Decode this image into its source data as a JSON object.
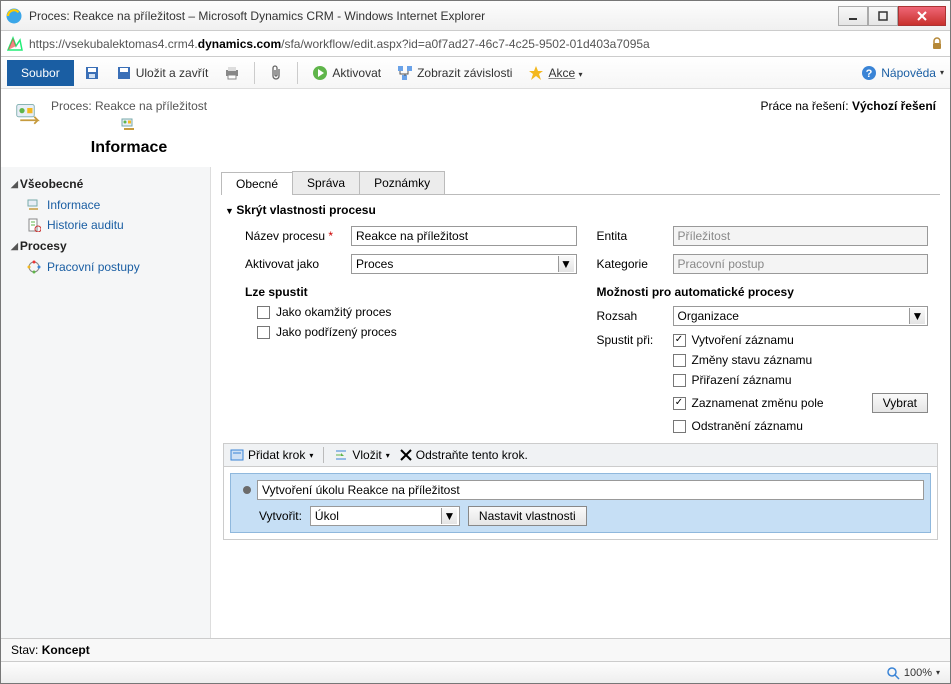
{
  "window": {
    "title": "Proces: Reakce na příležitost – Microsoft Dynamics CRM - Windows Internet Explorer"
  },
  "address": {
    "protocol": "https",
    "host_pre": "://vsekubalektomas4.crm4.",
    "host_bold": "dynamics.com",
    "path": "/sfa/workflow/edit.aspx?id=a0f7ad27-46c7-4c25-9502-01d403a7095a"
  },
  "ribbon": {
    "soubor": "Soubor",
    "save_close": "Uložit a zavřít",
    "activate": "Aktivovat",
    "show_deps": "Zobrazit závislosti",
    "actions": "Akce",
    "help": "Nápověda"
  },
  "header": {
    "subtitle": "Proces: Reakce na příležitost",
    "title": "Informace",
    "solution_label": "Práce na řešení:",
    "solution_value": "Výchozí řešení"
  },
  "sidebar": {
    "sec1": "Všeobecné",
    "items1": [
      {
        "label": "Informace"
      },
      {
        "label": "Historie auditu"
      }
    ],
    "sec2": "Procesy",
    "items2": [
      {
        "label": "Pracovní postupy"
      }
    ]
  },
  "tabs": {
    "general": "Obecné",
    "admin": "Správa",
    "notes": "Poznámky"
  },
  "form": {
    "hide_props": "Skrýt vlastnosti procesu",
    "name_label": "Název procesu",
    "name_value": "Reakce na příležitost",
    "activate_as_label": "Aktivovat jako",
    "activate_as_value": "Proces",
    "can_run": "Lze spustit",
    "chk_immediate": "Jako okamžitý proces",
    "chk_child": "Jako podřízený proces",
    "entity_label": "Entita",
    "entity_value": "Příležitost",
    "category_label": "Kategorie",
    "category_value": "Pracovní postup",
    "auto_opts": "Možnosti pro automatické procesy",
    "scope_label": "Rozsah",
    "scope_value": "Organizace",
    "trigger_label": "Spustit při:",
    "trg_create": "Vytvoření záznamu",
    "trg_status": "Změny stavu záznamu",
    "trg_assign": "Přiřazení záznamu",
    "trg_field": "Zaznamenat změnu pole",
    "trg_delete": "Odstranění záznamu",
    "select_btn": "Vybrat"
  },
  "steps": {
    "add_step": "Přidat krok",
    "insert": "Vložit",
    "delete": "Odstraňte tento krok.",
    "step_title": "Vytvoření úkolu Reakce na příležitost",
    "create_label": "Vytvořit:",
    "create_value": "Úkol",
    "set_props": "Nastavit vlastnosti"
  },
  "status": {
    "label": "Stav:",
    "value": "Koncept"
  },
  "iebar": {
    "zoom": "100%"
  }
}
